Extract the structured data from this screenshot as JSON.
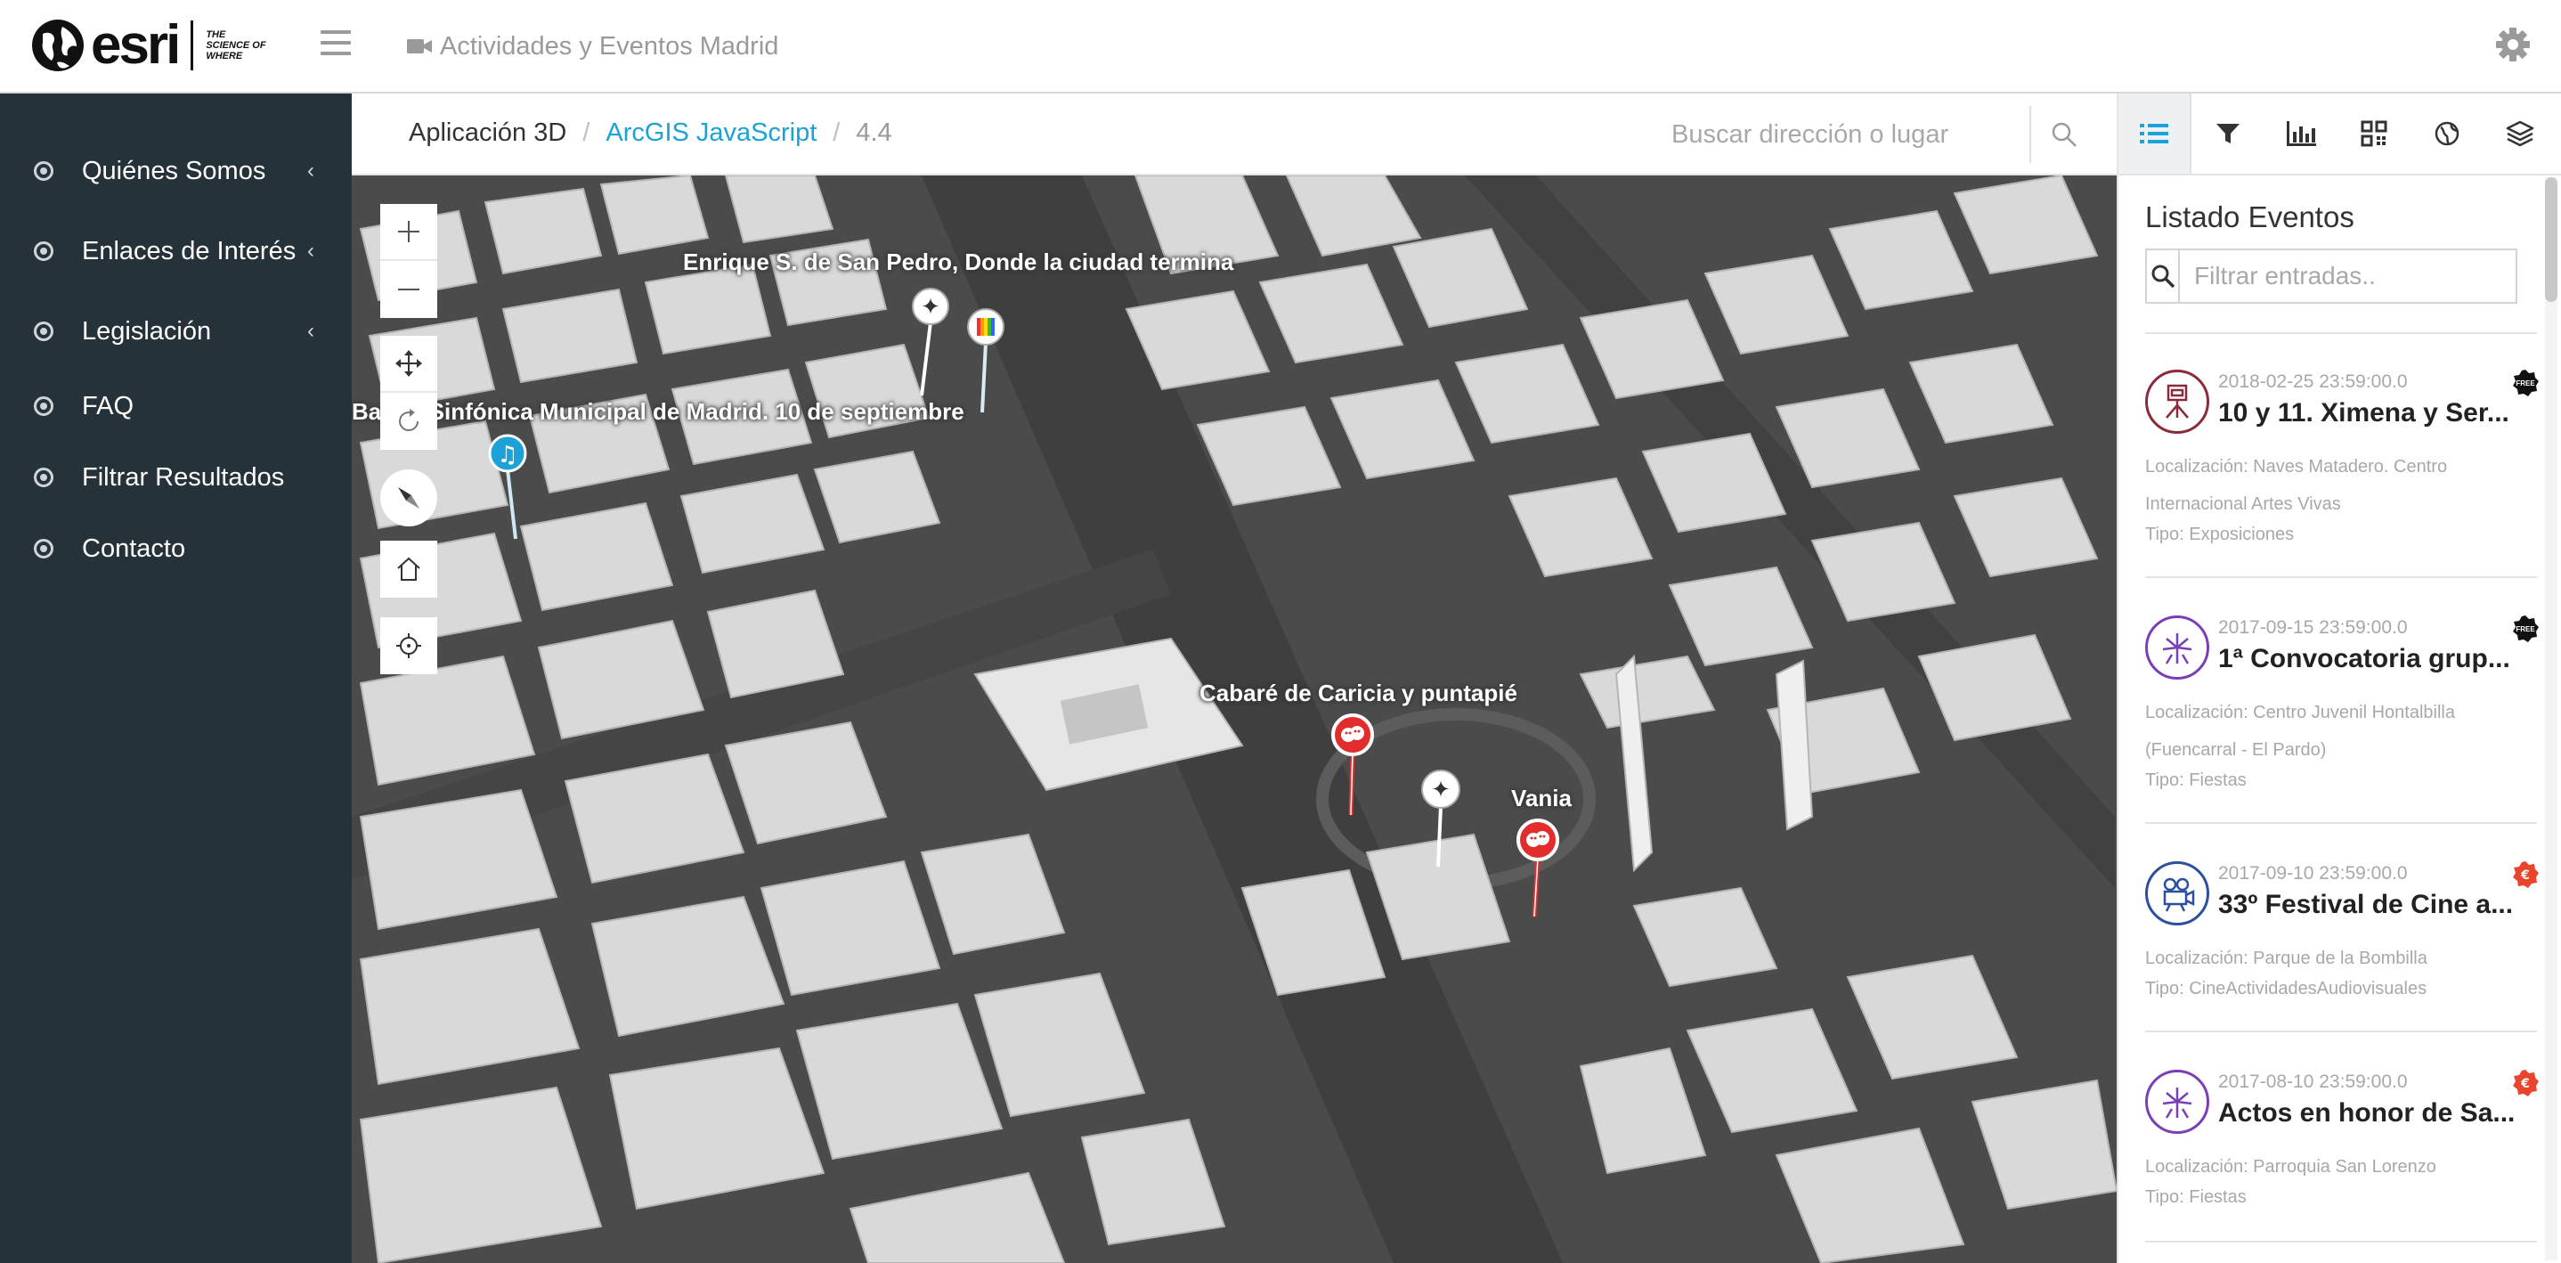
{
  "header": {
    "logo_text": "esri",
    "logo_tagline": "THE SCIENCE OF WHERE",
    "app_title": "Actividades y Eventos Madrid"
  },
  "sidebar": {
    "items": [
      {
        "label": "Quiénes Somos",
        "has_submenu": true
      },
      {
        "label": "Enlaces de Interés",
        "has_submenu": true
      },
      {
        "label": "Legislación",
        "has_submenu": true
      },
      {
        "label": "FAQ",
        "has_submenu": false
      },
      {
        "label": "Filtrar Resultados",
        "has_submenu": false
      },
      {
        "label": "Contacto",
        "has_submenu": false
      }
    ],
    "chevron": "‹"
  },
  "breadcrumb": {
    "items": [
      "Aplicación 3D",
      "ArcGIS JavaScript",
      "4.4"
    ],
    "separator": "/"
  },
  "search": {
    "placeholder": "Buscar dirección o lugar"
  },
  "toolbar": {
    "icons": [
      "list-icon",
      "filter-icon",
      "chart-icon",
      "qr-icon",
      "globe-icon",
      "layers-icon"
    ],
    "active": "list-icon"
  },
  "map": {
    "labels": [
      "Enrique S. de San Pedro, Donde la ciudad termina",
      "Banda Sinfónica Municipal de Madrid. 10 de septiembre",
      "Cabaré de Caricia y puntapié",
      "Vania"
    ],
    "pins": [
      {
        "name": "sparkle-pin",
        "icon": "✦",
        "color": "#ffffff"
      },
      {
        "name": "rainbow-pin",
        "icon": "|||",
        "color": "#ffffff"
      },
      {
        "name": "music-pin",
        "icon": "♫",
        "color": "#1ca2d6"
      },
      {
        "name": "theater-pin",
        "icon": "theater",
        "color": "#e32d2d"
      },
      {
        "name": "sparkle-pin",
        "icon": "✦",
        "color": "#ffffff"
      },
      {
        "name": "theater-pin",
        "icon": "theater",
        "color": "#e32d2d"
      }
    ]
  },
  "panel": {
    "title": "Listado Eventos",
    "filter_placeholder": "Filtrar entradas..",
    "events": [
      {
        "date": "2018-02-25 23:59:00.0",
        "title": "10 y 11. Ximena y Ser...",
        "location": "Localización: Naves Matadero. Centro Internacional Artes Vivas",
        "type": "Tipo: Exposiciones",
        "icon": "exhibition-icon",
        "color": "#8a2a3a",
        "badge": "FREE"
      },
      {
        "date": "2017-09-15 23:59:00.0",
        "title": "1ª Convocatoria grup...",
        "location": "Localización: Centro Juvenil Hontalbilla (Fuencarral - El Pardo)",
        "type": "Tipo: Fiestas",
        "icon": "fireworks-icon",
        "color": "#7a3fb8",
        "badge": "FREE"
      },
      {
        "date": "2017-09-10 23:59:00.0",
        "title": "33º Festival de Cine a...",
        "location": "Localización: Parque de la Bombilla",
        "type": "Tipo: CineActividadesAudiovisuales",
        "icon": "projector-icon",
        "color": "#2c4f9e",
        "badge": "€"
      },
      {
        "date": "2017-08-10 23:59:00.0",
        "title": "Actos en honor de Sa...",
        "location": "Localización: Parroquia San Lorenzo",
        "type": "Tipo: Fiestas",
        "icon": "fireworks-icon",
        "color": "#7a3fb8",
        "badge": "€"
      }
    ]
  }
}
